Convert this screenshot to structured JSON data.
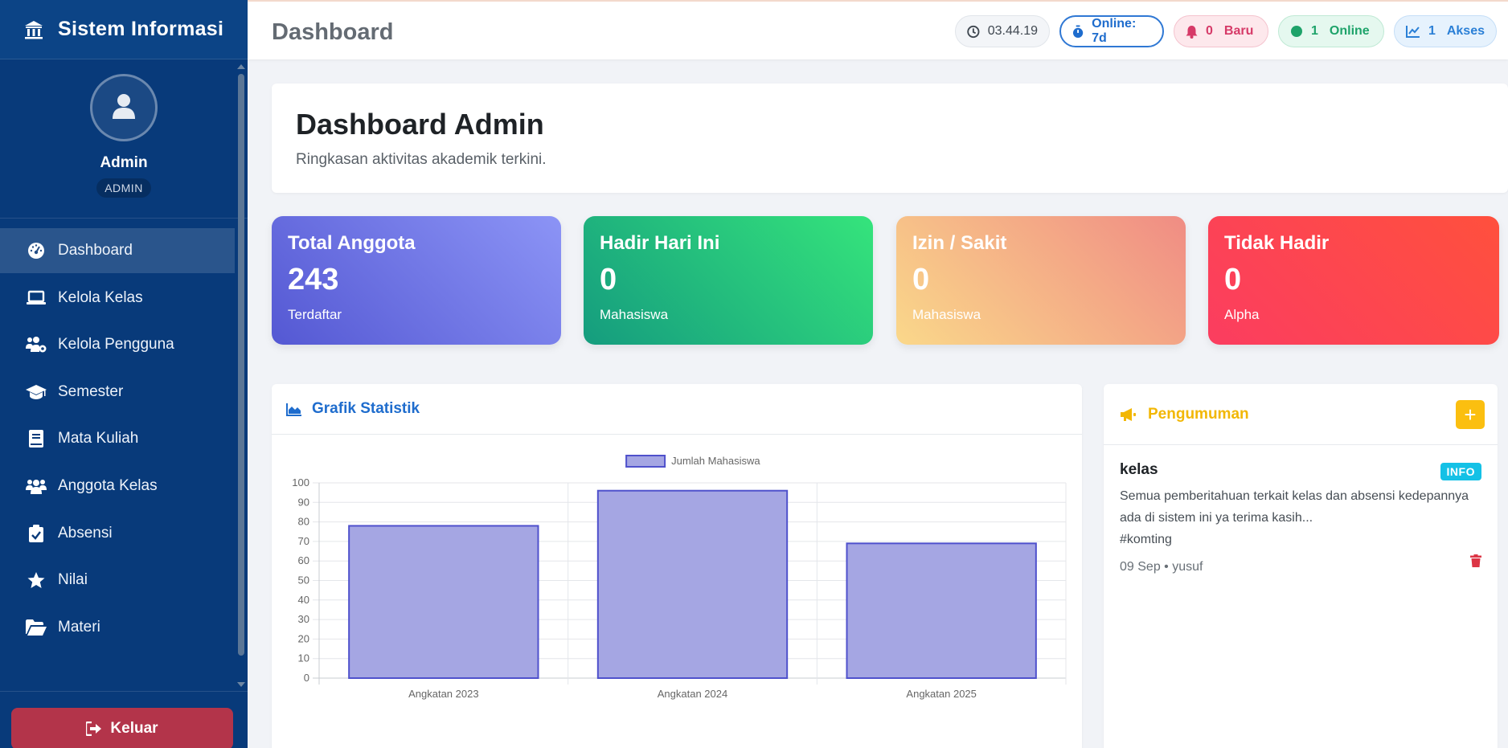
{
  "brand": {
    "title": "Sistem Informasi",
    "icon": "university-icon"
  },
  "profile": {
    "name": "Admin",
    "role": "ADMIN",
    "icon": "user-icon"
  },
  "menu": [
    {
      "label": "Dashboard",
      "icon": "dashboard-icon",
      "active": true
    },
    {
      "label": "Kelola Kelas",
      "icon": "laptop-icon"
    },
    {
      "label": "Kelola Pengguna",
      "icon": "users-cog-icon"
    },
    {
      "label": "Semester",
      "icon": "graduation-cap-icon"
    },
    {
      "label": "Mata Kuliah",
      "icon": "book-icon"
    },
    {
      "label": "Anggota Kelas",
      "icon": "users-icon"
    },
    {
      "label": "Absensi",
      "icon": "clipboard-check-icon"
    },
    {
      "label": "Nilai",
      "icon": "star-icon"
    },
    {
      "label": "Materi",
      "icon": "folder-open-icon"
    }
  ],
  "logout": {
    "label": "Keluar"
  },
  "topbar": {
    "title": "Dashboard",
    "time": "03.44.19",
    "online_duration": "Online: 7d",
    "new_count": "0",
    "new_label": "Baru",
    "online_count": "1",
    "online_label": "Online",
    "access_count": "1",
    "access_label": "Akses"
  },
  "welcome": {
    "title": "Dashboard Admin",
    "subtitle": "Ringkasan aktivitas akademik terkini."
  },
  "stats": [
    {
      "label": "Total Anggota",
      "value": "243",
      "foot": "Terdaftar"
    },
    {
      "label": "Hadir Hari Ini",
      "value": "0",
      "foot": "Mahasiswa"
    },
    {
      "label": "Izin / Sakit",
      "value": "0",
      "foot": "Mahasiswa"
    },
    {
      "label": "Tidak Hadir",
      "value": "0",
      "foot": "Alpha"
    }
  ],
  "chart_card": {
    "title": "Grafik Statistik"
  },
  "chart_data": {
    "type": "bar",
    "categories": [
      "Angkatan 2023",
      "Angkatan 2024",
      "Angkatan 2025"
    ],
    "series": [
      {
        "name": "Jumlah Mahasiswa",
        "values": [
          78,
          96,
          69
        ]
      }
    ],
    "ylim": [
      0,
      100
    ],
    "yticks": [
      0,
      10,
      20,
      30,
      40,
      50,
      60,
      70,
      80,
      90,
      100
    ],
    "legend": "top-center",
    "grid": true,
    "colors": {
      "fill": "#a5a6e3",
      "stroke": "#4f51cc"
    }
  },
  "announcement": {
    "title": "Pengumuman",
    "add_label": "+",
    "item": {
      "title": "kelas",
      "badge": "INFO",
      "text_line1": "Semua pemberitahuan terkait kelas dan absensi kedepannya",
      "text_line2": "ada di sistem ini ya terima kasih...",
      "text_line3": "#komting",
      "meta": "09 Sep • yusuf"
    }
  }
}
